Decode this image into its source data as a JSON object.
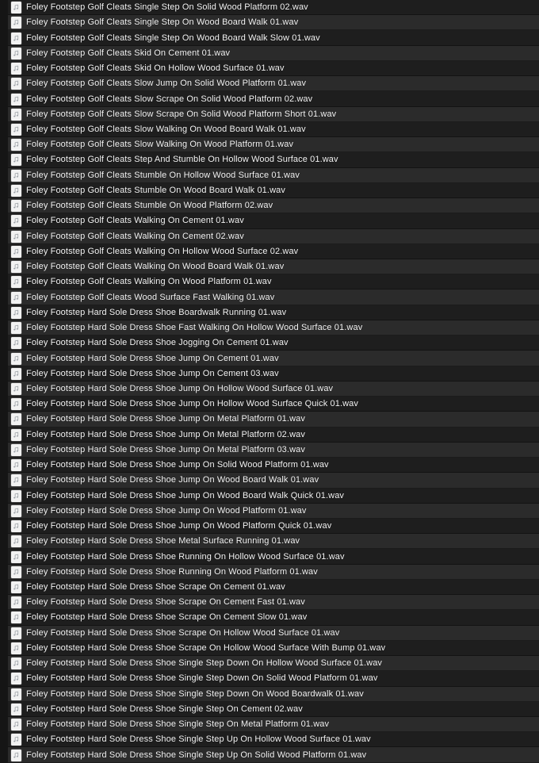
{
  "window": {
    "title": "Foley Footstep Sound Library",
    "background_color": "#151515",
    "row_color_odd": "#1e1e1e",
    "row_color_even": "#2b2b2b",
    "text_color": "#f4f4f4"
  },
  "icon": {
    "semantic_name": "audio-file-icon",
    "glyph": "music-note",
    "tile_color": "#f2f2f2"
  },
  "files": [
    {
      "name": "Foley Footstep Golf Cleats Single Step On Solid Wood Platform 02.wav"
    },
    {
      "name": "Foley Footstep Golf Cleats Single Step On Wood Board Walk 01.wav"
    },
    {
      "name": "Foley Footstep Golf Cleats Single Step On Wood Board Walk Slow 01.wav"
    },
    {
      "name": "Foley Footstep Golf Cleats Skid On Cement 01.wav"
    },
    {
      "name": "Foley Footstep Golf Cleats Skid On Hollow Wood Surface 01.wav"
    },
    {
      "name": "Foley Footstep Golf Cleats Slow Jump On Solid Wood Platform 01.wav"
    },
    {
      "name": "Foley Footstep Golf Cleats Slow Scrape On Solid Wood Platform 02.wav"
    },
    {
      "name": "Foley Footstep Golf Cleats Slow Scrape On Solid Wood Platform Short 01.wav"
    },
    {
      "name": "Foley Footstep Golf Cleats Slow Walking On Wood Board Walk 01.wav"
    },
    {
      "name": "Foley Footstep Golf Cleats Slow Walking On Wood Platform 01.wav"
    },
    {
      "name": "Foley Footstep Golf Cleats Step And Stumble On Hollow Wood Surface 01.wav"
    },
    {
      "name": "Foley Footstep Golf Cleats Stumble On Hollow Wood Surface 01.wav"
    },
    {
      "name": "Foley Footstep Golf Cleats Stumble On Wood Board Walk 01.wav"
    },
    {
      "name": "Foley Footstep Golf Cleats Stumble On Wood Platform 02.wav"
    },
    {
      "name": "Foley Footstep Golf Cleats Walking On Cement 01.wav"
    },
    {
      "name": "Foley Footstep Golf Cleats Walking On Cement 02.wav"
    },
    {
      "name": "Foley Footstep Golf Cleats Walking On Hollow Wood Surface 02.wav"
    },
    {
      "name": "Foley Footstep Golf Cleats Walking On Wood Board Walk 01.wav"
    },
    {
      "name": "Foley Footstep Golf Cleats Walking On Wood Platform 01.wav"
    },
    {
      "name": "Foley Footstep Golf Cleats Wood Surface Fast Walking 01.wav"
    },
    {
      "name": "Foley Footstep Hard Sole Dress Shoe Boardwalk Running 01.wav"
    },
    {
      "name": "Foley Footstep Hard Sole Dress Shoe Fast Walking On Hollow Wood Surface 01.wav"
    },
    {
      "name": "Foley Footstep Hard Sole Dress Shoe Jogging On Cement 01.wav"
    },
    {
      "name": "Foley Footstep Hard Sole Dress Shoe Jump On Cement 01.wav"
    },
    {
      "name": "Foley Footstep Hard Sole Dress Shoe Jump On Cement 03.wav"
    },
    {
      "name": "Foley Footstep Hard Sole Dress Shoe Jump On Hollow Wood Surface 01.wav"
    },
    {
      "name": "Foley Footstep Hard Sole Dress Shoe Jump On Hollow Wood Surface Quick 01.wav"
    },
    {
      "name": "Foley Footstep Hard Sole Dress Shoe Jump On Metal Platform 01.wav"
    },
    {
      "name": "Foley Footstep Hard Sole Dress Shoe Jump On Metal Platform 02.wav"
    },
    {
      "name": "Foley Footstep Hard Sole Dress Shoe Jump On Metal Platform 03.wav"
    },
    {
      "name": "Foley Footstep Hard Sole Dress Shoe Jump On Solid Wood Platform 01.wav"
    },
    {
      "name": "Foley Footstep Hard Sole Dress Shoe Jump On Wood Board Walk 01.wav"
    },
    {
      "name": "Foley Footstep Hard Sole Dress Shoe Jump On Wood Board Walk Quick 01.wav"
    },
    {
      "name": "Foley Footstep Hard Sole Dress Shoe Jump On Wood Platform 01.wav"
    },
    {
      "name": "Foley Footstep Hard Sole Dress Shoe Jump On Wood Platform Quick 01.wav"
    },
    {
      "name": "Foley Footstep Hard Sole Dress Shoe Metal Surface Running 01.wav"
    },
    {
      "name": "Foley Footstep Hard Sole Dress Shoe Running On Hollow Wood Surface 01.wav"
    },
    {
      "name": "Foley Footstep Hard Sole Dress Shoe Running On Wood Platform 01.wav"
    },
    {
      "name": "Foley Footstep Hard Sole Dress Shoe Scrape On Cement 01.wav"
    },
    {
      "name": "Foley Footstep Hard Sole Dress Shoe Scrape On Cement Fast 01.wav"
    },
    {
      "name": "Foley Footstep Hard Sole Dress Shoe Scrape On Cement Slow 01.wav"
    },
    {
      "name": "Foley Footstep Hard Sole Dress Shoe Scrape On Hollow Wood Surface 01.wav"
    },
    {
      "name": "Foley Footstep Hard Sole Dress Shoe Scrape On Hollow Wood Surface With Bump 01.wav"
    },
    {
      "name": "Foley Footstep Hard Sole Dress Shoe Single Step Down On Hollow Wood Surface 01.wav"
    },
    {
      "name": "Foley Footstep Hard Sole Dress Shoe Single Step Down On Solid Wood Platform 01.wav"
    },
    {
      "name": "Foley Footstep Hard Sole Dress Shoe Single Step Down On Wood Boardwalk 01.wav"
    },
    {
      "name": "Foley Footstep Hard Sole Dress Shoe Single Step On Cement 02.wav"
    },
    {
      "name": "Foley Footstep Hard Sole Dress Shoe Single Step On Metal Platform 01.wav"
    },
    {
      "name": "Foley Footstep Hard Sole Dress Shoe Single Step Up On Hollow Wood Surface 01.wav"
    },
    {
      "name": "Foley Footstep Hard Sole Dress Shoe Single Step Up On Solid Wood Platform 01.wav"
    }
  ]
}
